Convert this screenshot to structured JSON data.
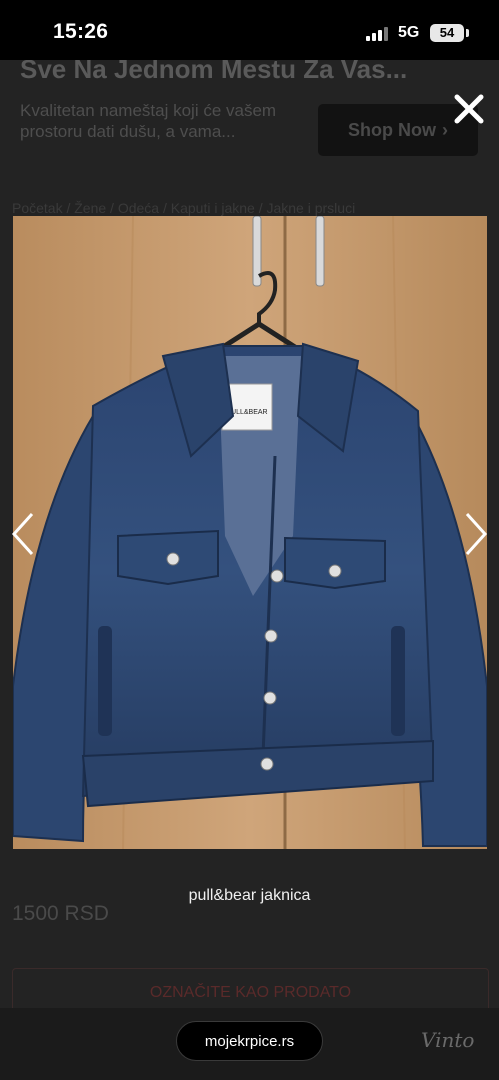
{
  "status_bar": {
    "time": "15:26",
    "network": "5G",
    "battery": "54"
  },
  "background_page": {
    "ad": {
      "title": "Sve Na Jednom Mestu Za Vas...",
      "description": "Kvalitetan nameštaj koji će vašem prostoru dati dušu, a vama...",
      "url": "",
      "button_label": "Shop Now"
    },
    "breadcrumb": "Početak / Žene / Odeća / Kaputi i jakne / Jakne i prsluci",
    "price": "1500 RSD",
    "mark_sold_label": "OZNAČITE KAO PRODATO"
  },
  "lightbox": {
    "caption": "pull&bear jaknica",
    "tag_label": "PULL&BEAR",
    "colors": {
      "wood": "#c59a6c",
      "denim": "#2f4a72",
      "denim_dark": "#1d3050"
    }
  },
  "browser": {
    "url": "mojekrpice.rs",
    "brand": "Vinto"
  }
}
